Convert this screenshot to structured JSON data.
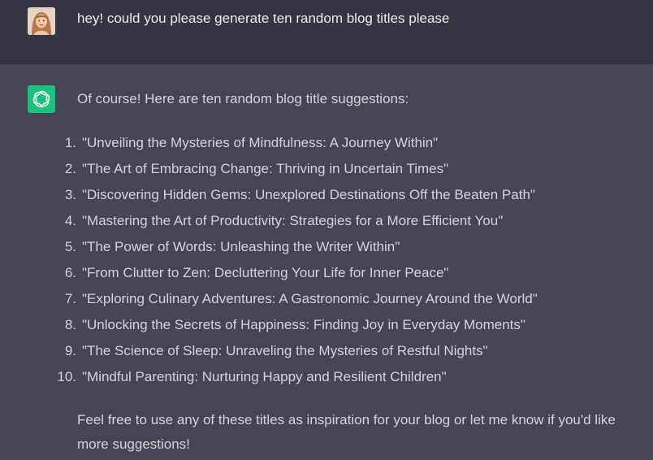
{
  "user_message": {
    "avatar": "user-avatar",
    "text": "hey! could you please generate ten random blog titles please"
  },
  "assistant_message": {
    "icon": "openai-logo-icon",
    "intro": "Of course! Here are ten random blog title suggestions:",
    "titles": [
      {
        "num": "1.",
        "text": "\"Unveiling the Mysteries of Mindfulness: A Journey Within\""
      },
      {
        "num": "2.",
        "text": "\"The Art of Embracing Change: Thriving in Uncertain Times\""
      },
      {
        "num": "3.",
        "text": "\"Discovering Hidden Gems: Unexplored Destinations Off the Beaten Path\""
      },
      {
        "num": "4.",
        "text": "\"Mastering the Art of Productivity: Strategies for a More Efficient You\""
      },
      {
        "num": "5.",
        "text": "\"The Power of Words: Unleashing the Writer Within\""
      },
      {
        "num": "6.",
        "text": "\"From Clutter to Zen: Decluttering Your Life for Inner Peace\""
      },
      {
        "num": "7.",
        "text": "\"Exploring Culinary Adventures: A Gastronomic Journey Around the World\""
      },
      {
        "num": "8.",
        "text": "\"Unlocking the Secrets of Happiness: Finding Joy in Everyday Moments\""
      },
      {
        "num": "9.",
        "text": "\"The Science of Sleep: Unraveling the Mysteries of Restful Nights\""
      },
      {
        "num": "10.",
        "text": "\"Mindful Parenting: Nurturing Happy and Resilient Children\""
      }
    ],
    "outro": "Feel free to use any of these titles as inspiration for your blog or let me know if you'd like more suggestions!"
  },
  "colors": {
    "user_bg": "#343541",
    "assistant_bg": "#444654",
    "brand": "#19c37d"
  }
}
